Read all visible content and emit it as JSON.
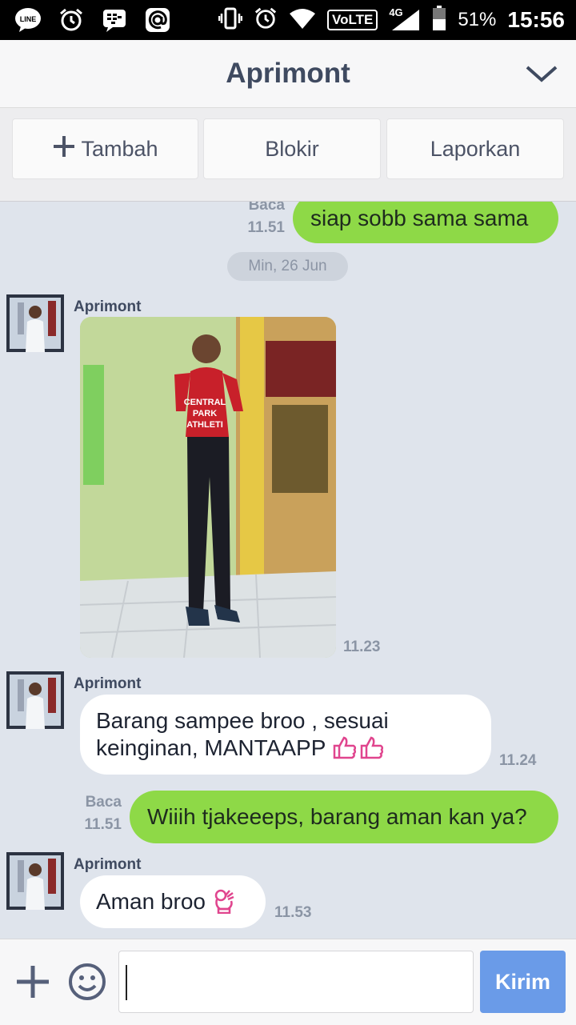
{
  "status_bar": {
    "network": "4G",
    "volte": "VoLTE",
    "battery": "51%",
    "time": "15:56",
    "left_icons": [
      "line-app-icon",
      "alarm-icon",
      "blackberry-icon",
      "at-sign-icon"
    ],
    "right_icons": [
      "vibrate-icon",
      "alarm-icon",
      "wifi-icon",
      "volte-icon",
      "signal-icon",
      "battery-icon"
    ]
  },
  "header": {
    "title": "Aprimont"
  },
  "actions": {
    "add_label": "Tambah",
    "block_label": "Blokir",
    "report_label": "Laporkan"
  },
  "chat": {
    "date_divider": "Min, 26 Jun",
    "messages": [
      {
        "direction": "out",
        "text": "siap sobb sama sama",
        "status": "Baca",
        "time": "11.51"
      },
      {
        "direction": "in",
        "sender": "Aprimont",
        "type": "photo",
        "time": "11.23"
      },
      {
        "direction": "in",
        "sender": "Aprimont",
        "text": "Barang sampee broo , sesuai keinginan, MANTAAPP",
        "time": "11.24"
      },
      {
        "direction": "out",
        "text": "Wiiih tjakeeeps, barang aman kan ya?",
        "status": "Baca",
        "time": "11.51"
      },
      {
        "direction": "in",
        "sender": "Aprimont",
        "text": "Aman broo",
        "time": "11.53"
      }
    ]
  },
  "input": {
    "value": "",
    "placeholder": "",
    "send_label": "Kirim"
  },
  "colors": {
    "outgoing_bubble": "#8ed947",
    "incoming_bubble": "#ffffff",
    "chat_bg": "#dfe4ec",
    "send_button": "#6a9be8",
    "header_text": "#3f4a60"
  }
}
